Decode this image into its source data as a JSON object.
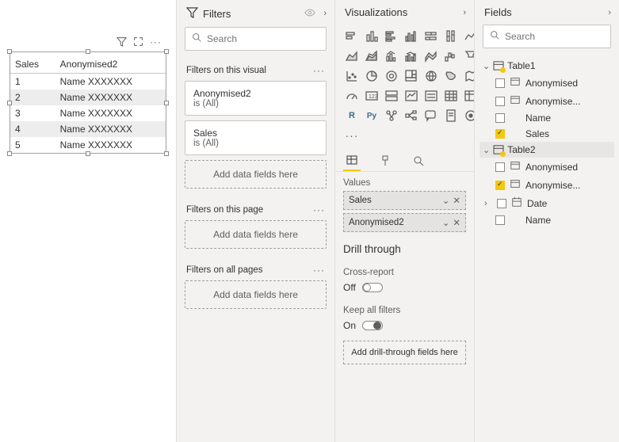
{
  "canvas": {
    "table": {
      "headers": [
        "Sales",
        "Anonymised2"
      ],
      "rows": [
        {
          "c1": "1",
          "c2": "Name XXXXXXX"
        },
        {
          "c1": "2",
          "c2": "Name XXXXXXX"
        },
        {
          "c1": "3",
          "c2": "Name XXXXXXX"
        },
        {
          "c1": "4",
          "c2": "Name XXXXXXX"
        },
        {
          "c1": "5",
          "c2": "Name XXXXXXX"
        }
      ]
    }
  },
  "filters": {
    "title": "Filters",
    "search_placeholder": "Search",
    "section_visual": "Filters on this visual",
    "section_page": "Filters on this page",
    "section_all": "Filters on all pages",
    "card_anon_name": "Anonymised2",
    "card_anon_sub": "is (All)",
    "card_sales_name": "Sales",
    "card_sales_sub": "is (All)",
    "drop_text": "Add data fields here"
  },
  "viz": {
    "title": "Visualizations",
    "values_label": "Values",
    "value_sales": "Sales",
    "value_anon": "Anonymised2",
    "drill_title": "Drill through",
    "drill_cross": "Cross-report",
    "drill_off": "Off",
    "drill_keep": "Keep all filters",
    "drill_on": "On",
    "drill_drop": "Add drill-through fields here"
  },
  "fields": {
    "title": "Fields",
    "search_placeholder": "Search",
    "t1": "Table1",
    "t1_anon": "Anonymised",
    "t1_anone": "Anonymise...",
    "t1_name": "Name",
    "t1_sales": "Sales",
    "t2": "Table2",
    "t2_anon": "Anonymised",
    "t2_anone": "Anonymise...",
    "t2_date": "Date",
    "t2_name": "Name"
  }
}
